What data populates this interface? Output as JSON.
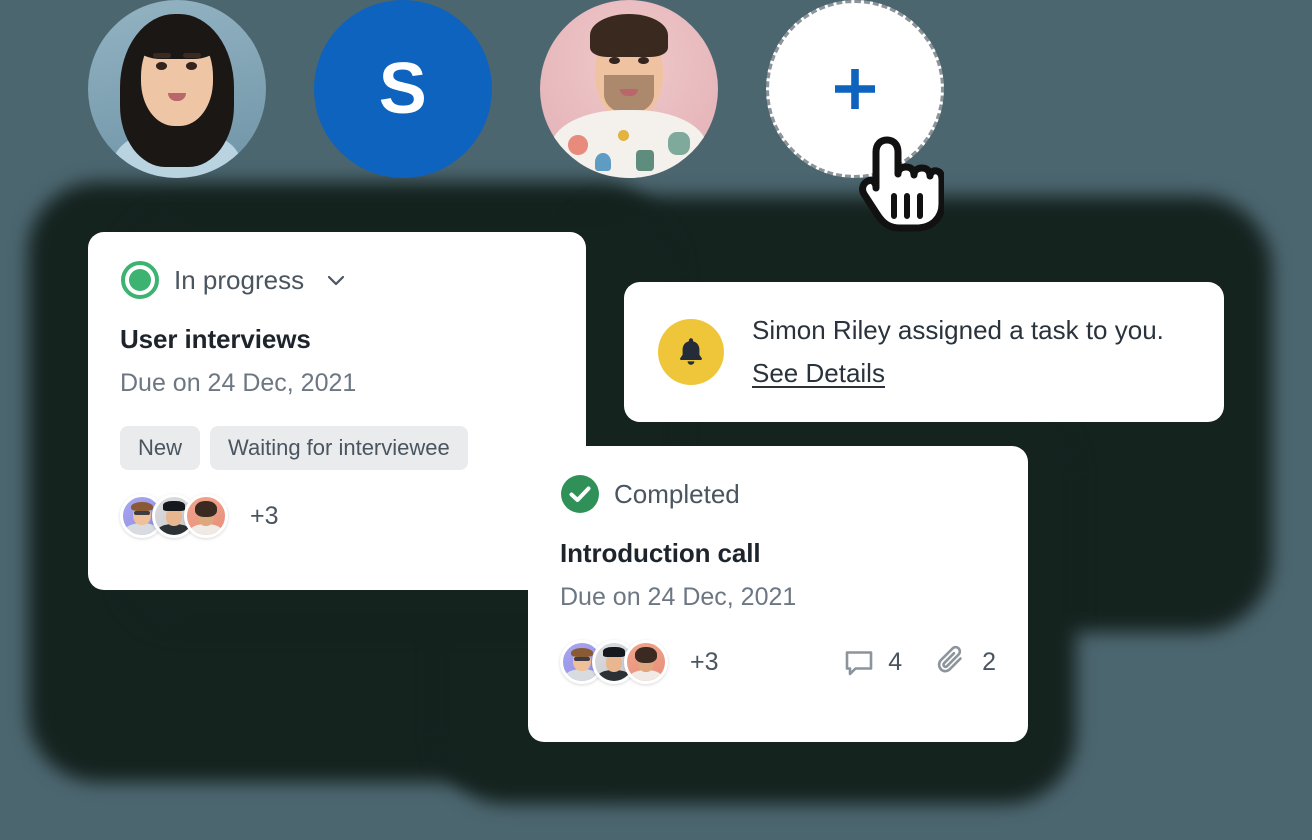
{
  "theme": {
    "background": "#4c6670",
    "blob": "#15231f",
    "card_bg": "#ffffff",
    "brand_blue": "#0d63be",
    "status_green": "#3cb371",
    "completed_green": "#2f9157",
    "bell_yellow": "#efc63a",
    "tag_bg": "#e9ebed",
    "title_text": "#1d242b",
    "body_text": "#4a5560",
    "muted_text": "#6d7783"
  },
  "avatar_row": {
    "name": "team-avatar-stack",
    "members": [
      {
        "type": "photo",
        "name": "avatar-woman-dark-hair",
        "icon": "person-photo-icon"
      },
      {
        "type": "initials",
        "name": "avatar-initials-s",
        "initials": "S"
      },
      {
        "type": "photo",
        "name": "avatar-man-patterned-hoodie",
        "icon": "person-photo-icon"
      }
    ],
    "add_button": {
      "name": "add-member-button",
      "icon": "plus-icon",
      "label": "+"
    },
    "cursor": {
      "name": "hand-pointer-cursor",
      "icon": "pointing-hand-icon"
    }
  },
  "cards": {
    "in_progress": {
      "status": {
        "label": "In progress",
        "icon": "pie-progress-icon",
        "color": "#3cb371",
        "chevron": "chevron-down-icon"
      },
      "title": "User interviews",
      "due": "Due on 24 Dec, 2021",
      "tags": [
        "New",
        "Waiting for interviewee"
      ],
      "assignees": {
        "avatars": [
          "avatar-man-glasses",
          "avatar-woman-cap",
          "avatar-woman-bob"
        ],
        "overflow": "+3"
      }
    },
    "notification": {
      "icon": "bell-icon",
      "message": "Simon Riley assigned a task to you.",
      "link_label": "See Details"
    },
    "completed": {
      "status": {
        "label": "Completed",
        "icon": "check-circle-icon",
        "color": "#2f9157"
      },
      "title": "Introduction call",
      "due": "Due on 24 Dec, 2021",
      "assignees": {
        "avatars": [
          "avatar-man-glasses",
          "avatar-woman-cap",
          "avatar-woman-bob"
        ],
        "overflow": "+3"
      },
      "counts": [
        {
          "icon": "comment-icon",
          "value": "4"
        },
        {
          "icon": "attachment-icon",
          "value": "2"
        }
      ]
    }
  }
}
